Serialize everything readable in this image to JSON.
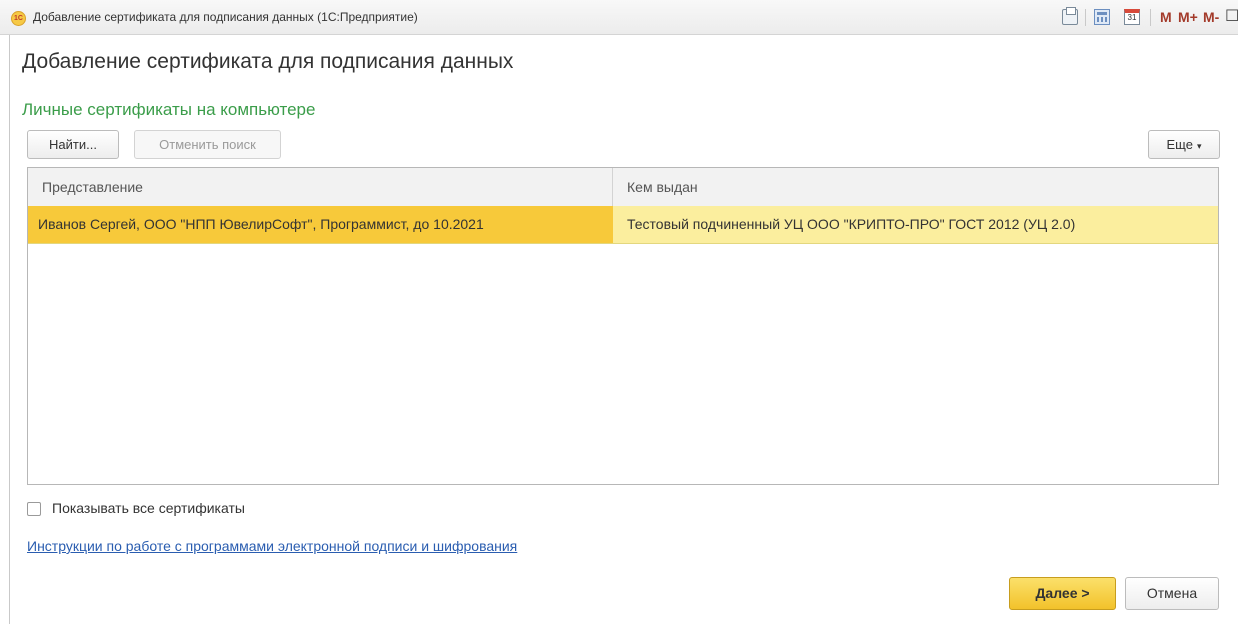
{
  "window": {
    "title": "Добавление сертификата для подписания данных  (1С:Предприятие)",
    "logo_text": "1С",
    "memory_buttons": [
      "M",
      "M+",
      "M-"
    ],
    "calendar_day": "31",
    "maximize_symbol": "☐",
    "close_symbol": "✕"
  },
  "form": {
    "title": "Добавление сертификата для подписания данных",
    "group_title": "Личные сертификаты на компьютере"
  },
  "toolbar": {
    "find_label": "Найти...",
    "cancel_search_label": "Отменить поиск",
    "more_label": "Еще",
    "more_arrow": "▾"
  },
  "table": {
    "columns": [
      "Представление",
      "Кем выдан"
    ],
    "rows": [
      {
        "presentation": "Иванов Сергей, ООО \"НПП ЮвелирСофт\", Программист, до 10.2021",
        "issued_by": "Тестовый подчиненный УЦ ООО \"КРИПТО-ПРО\" ГОСТ 2012 (УЦ 2.0)",
        "selected": true
      }
    ]
  },
  "show_all": {
    "label": "Показывать все сертификаты",
    "checked": false
  },
  "instructions_link": "Инструкции по работе с программами электронной подписи и шифрования",
  "footer": {
    "next_label": "Далее >",
    "cancel_label": "Отмена"
  },
  "colors": {
    "accent_green": "#3b9d4a",
    "selected_row": "#fbee9e",
    "selected_cell": "#f7c93a",
    "default_button": "#f2c22b",
    "link": "#2a5db0"
  }
}
